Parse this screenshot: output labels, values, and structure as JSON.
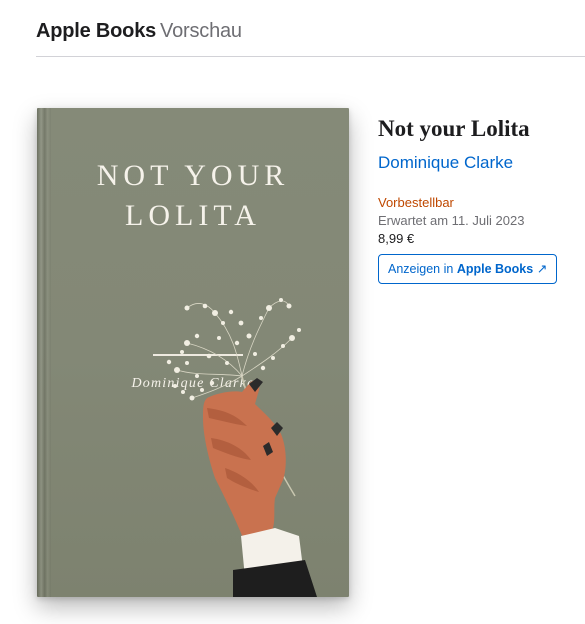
{
  "header": {
    "brand": "Apple Books",
    "subtitle": "Vorschau"
  },
  "cover": {
    "title_line1": "NOT YOUR",
    "title_line2": "LOLITA",
    "author": "Dominique Clarke"
  },
  "book": {
    "title": "Not your Lolita",
    "author": "Dominique Clarke",
    "status": "Vorbestellbar",
    "expected": "Erwartet am 11. Juli 2023",
    "price": "8,99 €"
  },
  "cta": {
    "prefix": "Anzeigen in",
    "brand": "Apple Books",
    "arrow": "↗"
  },
  "colors": {
    "accent": "#0066cc",
    "status": "#bf4800",
    "cover": "#838876"
  }
}
